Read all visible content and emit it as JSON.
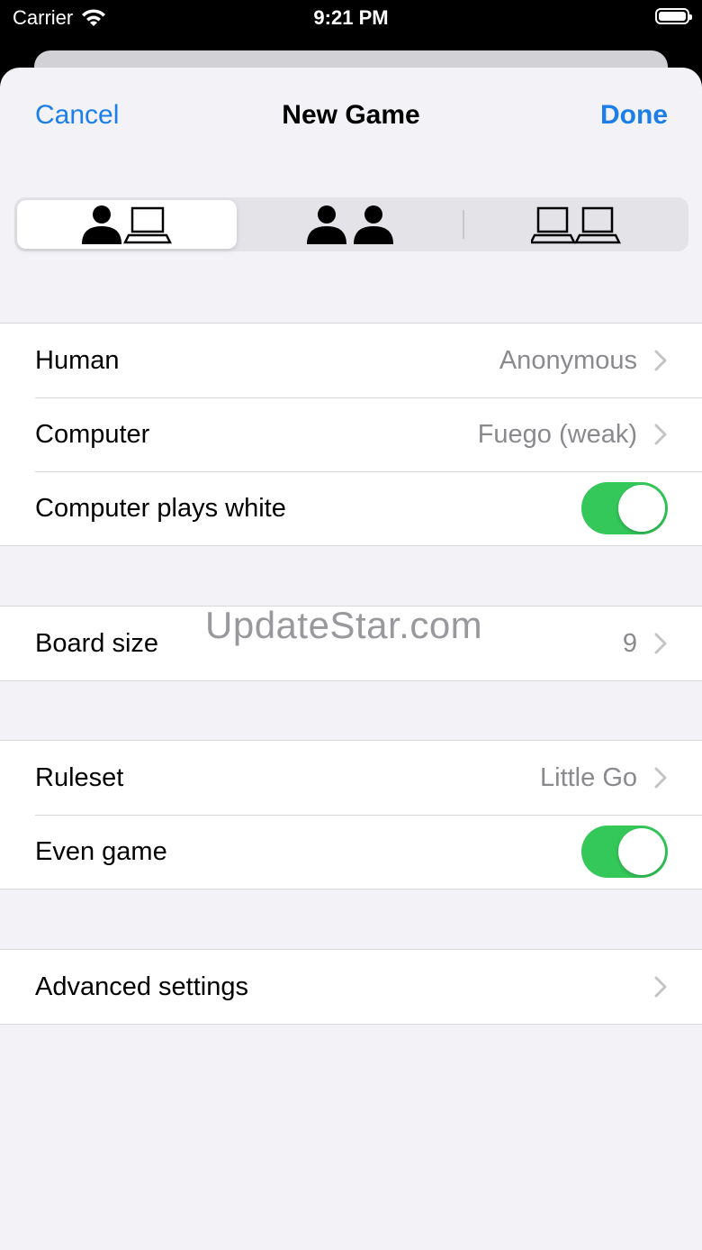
{
  "status_bar": {
    "carrier": "Carrier",
    "time": "9:21 PM"
  },
  "nav": {
    "cancel_label": "Cancel",
    "title": "New Game",
    "done_label": "Done"
  },
  "segments": [
    {
      "icon": "human-vs-computer-icon",
      "selected": true
    },
    {
      "icon": "human-vs-human-icon",
      "selected": false
    },
    {
      "icon": "computer-vs-computer-icon",
      "selected": false
    }
  ],
  "players": {
    "human_label": "Human",
    "human_value": "Anonymous",
    "computer_label": "Computer",
    "computer_value": "Fuego (weak)",
    "computer_white_label": "Computer plays white",
    "computer_white_on": true
  },
  "board": {
    "label": "Board size",
    "value": "9"
  },
  "rules": {
    "ruleset_label": "Ruleset",
    "ruleset_value": "Little Go",
    "even_game_label": "Even game",
    "even_game_on": true
  },
  "advanced": {
    "label": "Advanced settings"
  },
  "watermark": "UpdateStar.com",
  "colors": {
    "accent": "#1c7ee8",
    "toggle_on": "#34c759",
    "background": "#f2f2f7"
  }
}
